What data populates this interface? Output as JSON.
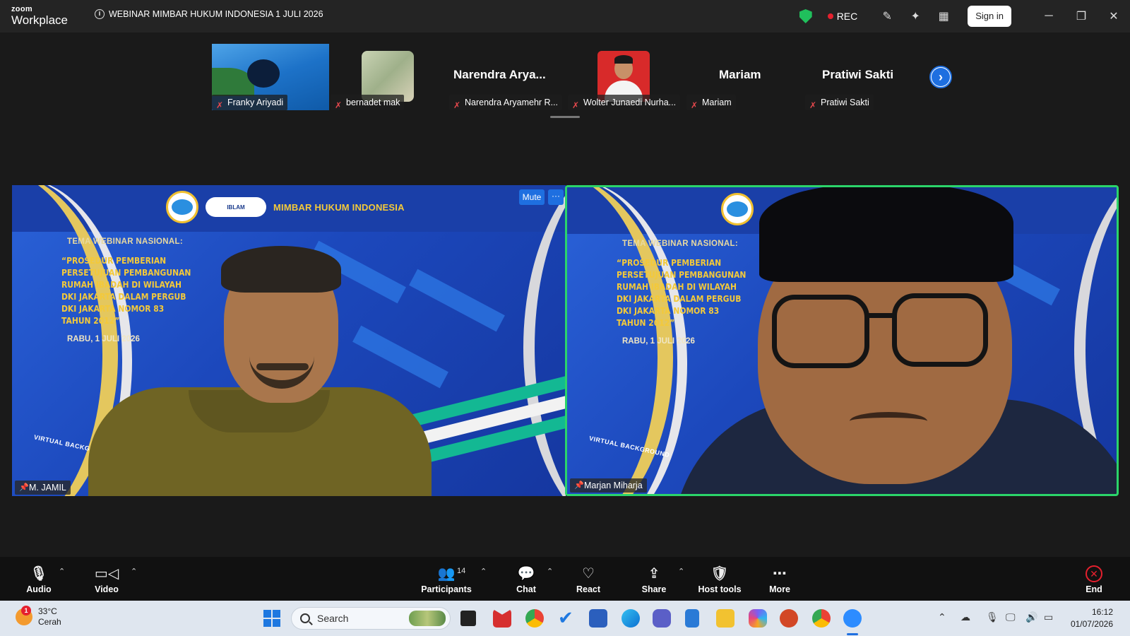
{
  "app": {
    "brand_top": "zoom",
    "brand_bottom": "Workplace",
    "meeting_title": "WEBINAR MIMBAR HUKUM INDONESIA 1 JULI 2026",
    "rec_label": "REC",
    "signin_label": "Sign in"
  },
  "thumbnails": [
    {
      "name": "Franky Ariyadi",
      "muted": true,
      "kind": "video"
    },
    {
      "name": "bernadet mak",
      "muted": true,
      "kind": "photo"
    },
    {
      "name": "Narendra Aryamehr R...",
      "display": "Narendra Arya...",
      "muted": true,
      "kind": "name"
    },
    {
      "name": "Wolter Junaedi Nurha...",
      "muted": true,
      "kind": "photo"
    },
    {
      "name": "Mariam",
      "display": "Mariam",
      "muted": true,
      "kind": "name"
    },
    {
      "name": "Pratiwi Sakti",
      "display": "Pratiwi Sakti",
      "muted": true,
      "kind": "name"
    }
  ],
  "slide": {
    "org": "MIMBAR HUKUM INDONESIA",
    "partner": "IBLAM",
    "theme_label": "TEMA WEBINAR NASIONAL:",
    "theme_body": "“PROSEDUR PEMBERIAN PERSETUJUAN PEMBANGUNAN RUMAH IBADAH DI WILAYAH DKI JAKARTA DALAM PERGUB DKI JAKARTA NOMOR 83 TAHUN 2012”",
    "date": "RABU, 1 JULI 2026",
    "vbg": "VIRTUAL BACKGROUND",
    "vbg_short": "VIRTUAL BACKGROU"
  },
  "videos": [
    {
      "name": "M. JAMIL",
      "pinned": true
    },
    {
      "name": "Marjan Miharja",
      "pinned": true,
      "active_speaker": true
    }
  ],
  "tile_controls": {
    "mute": "Mute",
    "more": "···"
  },
  "toolbar": {
    "audio": "Audio",
    "video": "Video",
    "participants": "Participants",
    "participants_count": "14",
    "chat": "Chat",
    "react": "React",
    "share": "Share",
    "host_tools": "Host tools",
    "more": "More",
    "end": "End"
  },
  "taskbar": {
    "temperature": "33°C",
    "weather": "Cerah",
    "weather_badge": "1",
    "search_placeholder": "Search",
    "time": "16:12",
    "date": "01/07/2026"
  },
  "colors": {
    "active_speaker_border": "#2bd46a",
    "accent": "#1e6fe0",
    "rec_dot": "#e5202e",
    "slide_gold": "#f3c93a"
  }
}
